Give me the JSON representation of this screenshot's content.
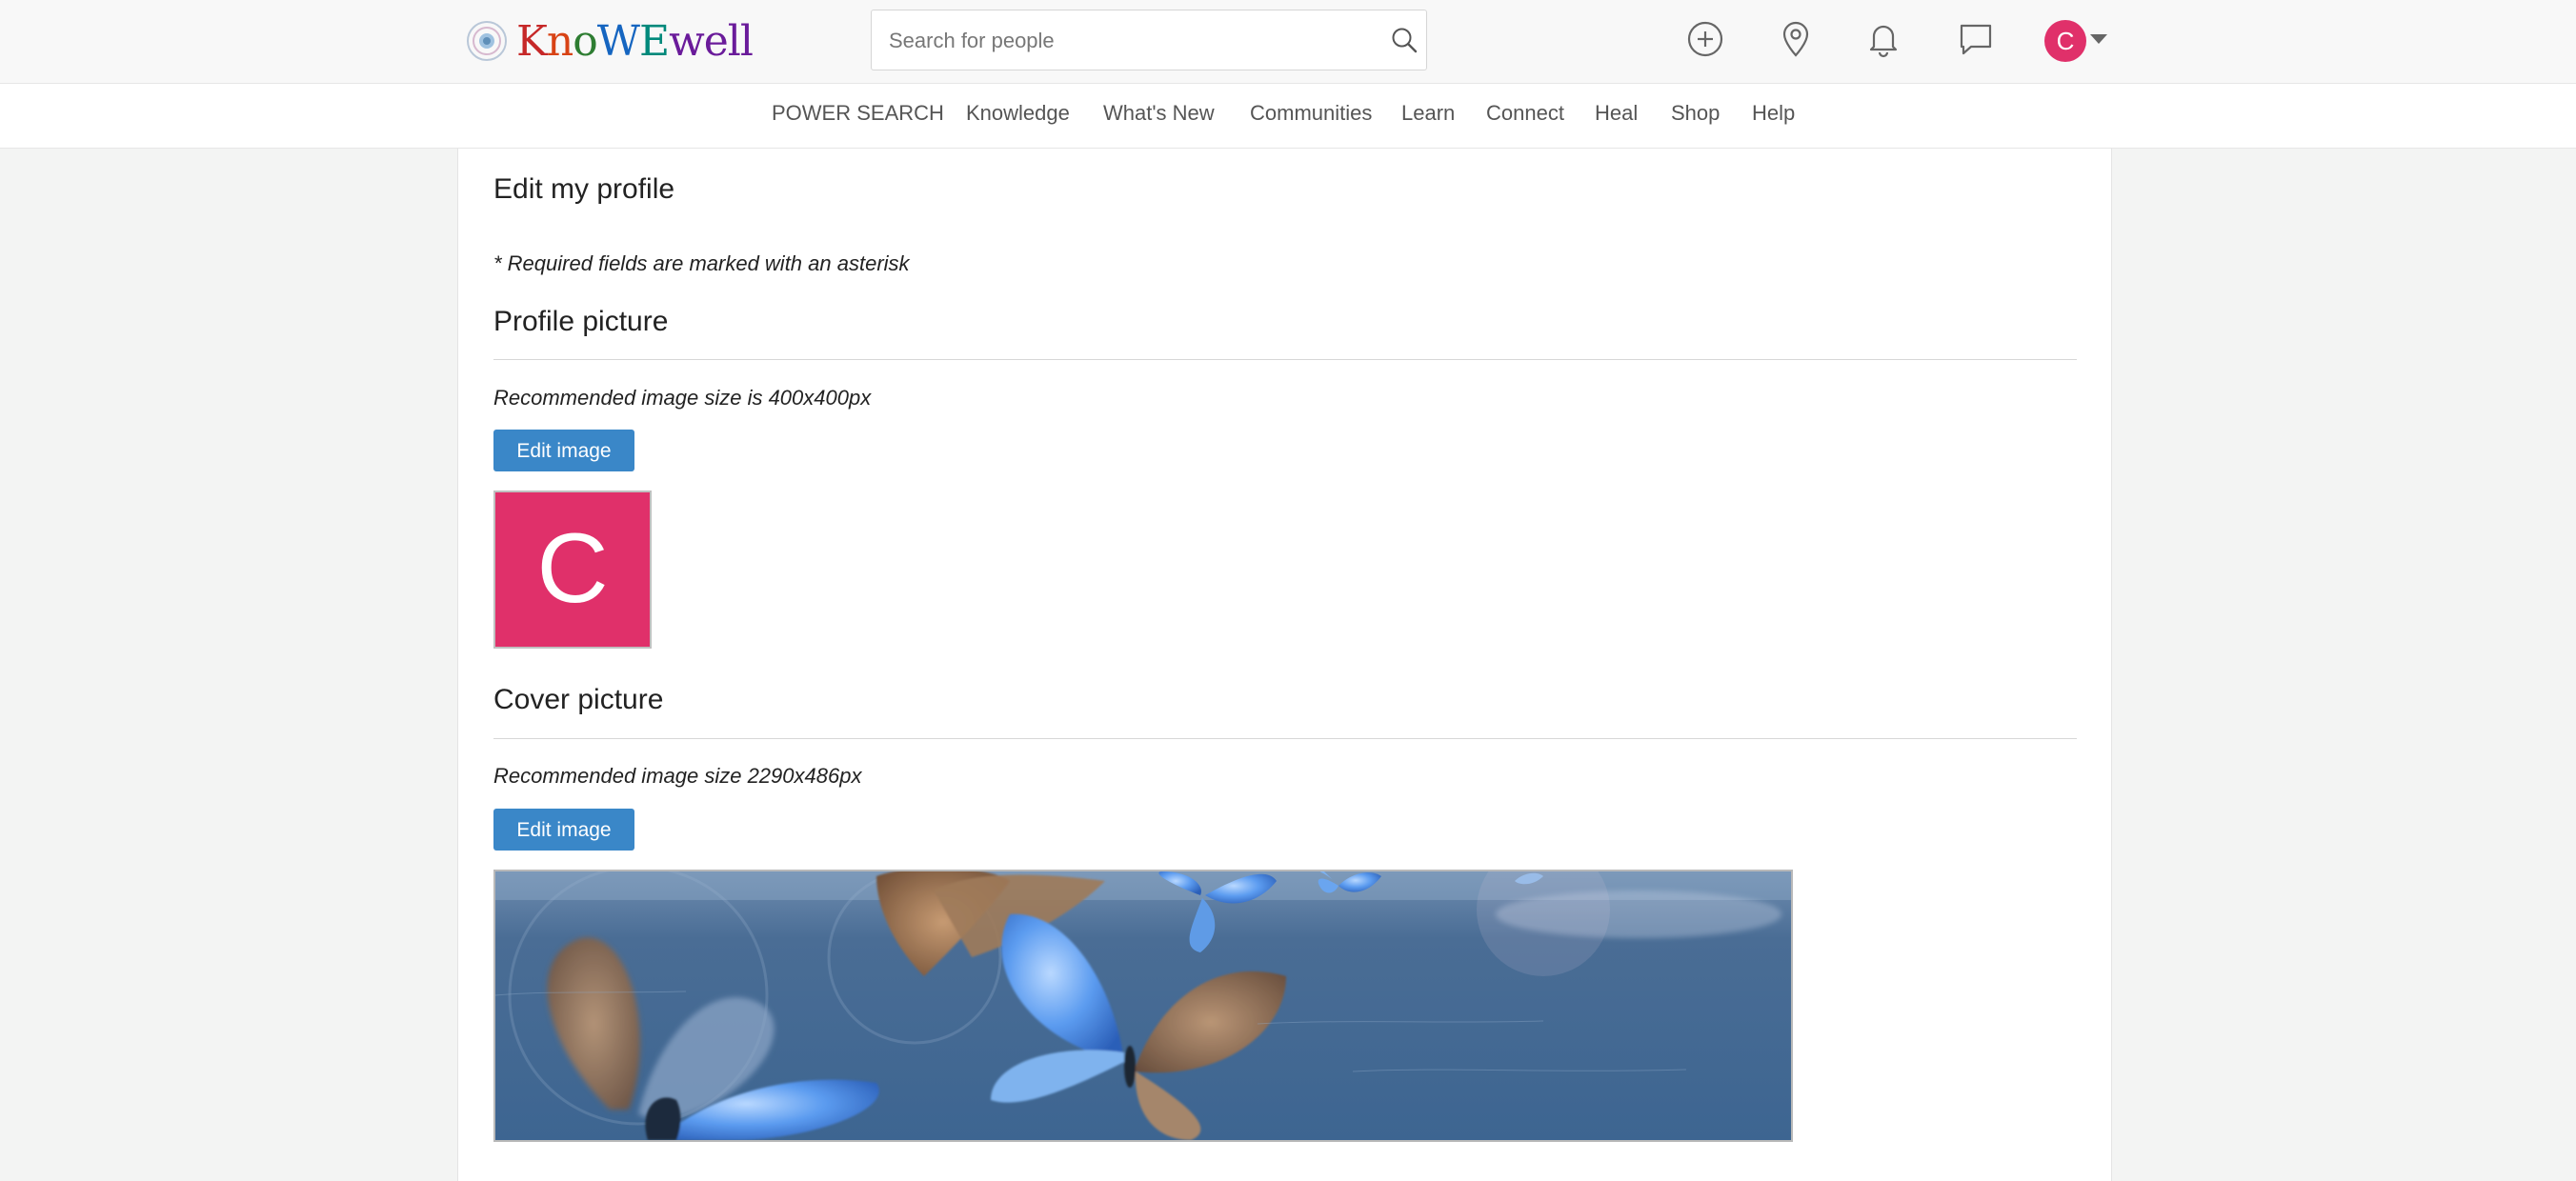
{
  "header": {
    "logo_text": "KnoWEwell",
    "search": {
      "placeholder": "Search for people",
      "value": ""
    },
    "icons": [
      "add-icon",
      "location-icon",
      "bell-icon",
      "chat-icon"
    ],
    "user": {
      "initial": "C",
      "avatar_color": "#e0306a"
    }
  },
  "nav": {
    "items": [
      {
        "label": "POWER SEARCH"
      },
      {
        "label": "Knowledge"
      },
      {
        "label": "What's New"
      },
      {
        "label": "Communities"
      },
      {
        "label": "Learn"
      },
      {
        "label": "Connect"
      },
      {
        "label": "Heal"
      },
      {
        "label": "Shop"
      },
      {
        "label": "Help"
      }
    ]
  },
  "page": {
    "title": "Edit my profile",
    "required_note": "* Required fields are marked with an asterisk",
    "profile_picture": {
      "heading": "Profile picture",
      "hint": "Recommended image size is 400x400px",
      "button_label": "Edit image",
      "initial": "C"
    },
    "cover_picture": {
      "heading": "Cover picture",
      "hint": "Recommended image size 2290x486px",
      "button_label": "Edit image"
    }
  },
  "colors": {
    "accent": "#3a87c8",
    "avatar": "#e0306a",
    "background": "#f3f4f3"
  }
}
